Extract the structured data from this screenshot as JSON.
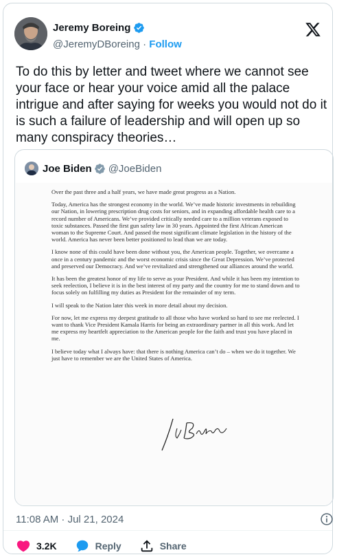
{
  "author": {
    "name": "Jeremy Boreing",
    "handle": "@JeremyDBoreing",
    "separator": "·",
    "follow_label": "Follow"
  },
  "tweet": {
    "text": "To do this by letter and tweet where we cannot see your face or hear your voice amid all the palace intrigue and after saying for weeks you would not do it is such a failure of leadership and will open up so many conspiracy theories…",
    "timestamp": "11:08 AM · Jul 21, 2024"
  },
  "quoted": {
    "name": "Joe Biden",
    "handle": "@JoeBiden",
    "letter": {
      "paragraphs": [
        "Over the past three and a half years, we have made great progress as a Nation.",
        "Today, America has the strongest economy in the world. We’ve made historic investments in rebuilding our Nation, in lowering prescription drug costs for seniors, and in expanding affordable health care to a record number of Americans. We’ve provided critically needed care to a million veterans exposed to toxic substances. Passed the first gun safety law in 30 years. Appointed the first African American woman to the Supreme Court. And passed the most significant climate legislation in the history of the world. America has never been better positioned to lead than we are today.",
        "I know none of this could have been done without you, the American people. Together, we overcame a once in a century pandemic and the worst economic crisis since the Great Depression. We’ve protected and preserved our Democracy. And we’ve revitalized and strengthened our alliances around the world.",
        "It has been the greatest honor of my life to serve as your President. And while it has been my intention to seek reelection, I believe it is in the best interest of my party and the country for me to stand down and to focus solely on fulfilling my duties as President for the remainder of my term.",
        "I will speak to the Nation later this week in more detail about my decision.",
        "For now, let me express my deepest gratitude to all those who have worked so hard to see me reelected. I want to thank Vice President Kamala Harris for being an extraordinary partner in all this work. And let me express my heartfelt appreciation to the American people for the faith and trust you have placed in me.",
        "I believe today what I always have: that there is nothing America can’t do – when we do it together. We just have to remember we are the United States of America."
      ]
    }
  },
  "actions": {
    "likes": "3.2K",
    "reply_label": "Reply",
    "share_label": "Share"
  },
  "colors": {
    "accent": "#1d9bf0",
    "like": "#f91880",
    "muted": "#536471"
  }
}
